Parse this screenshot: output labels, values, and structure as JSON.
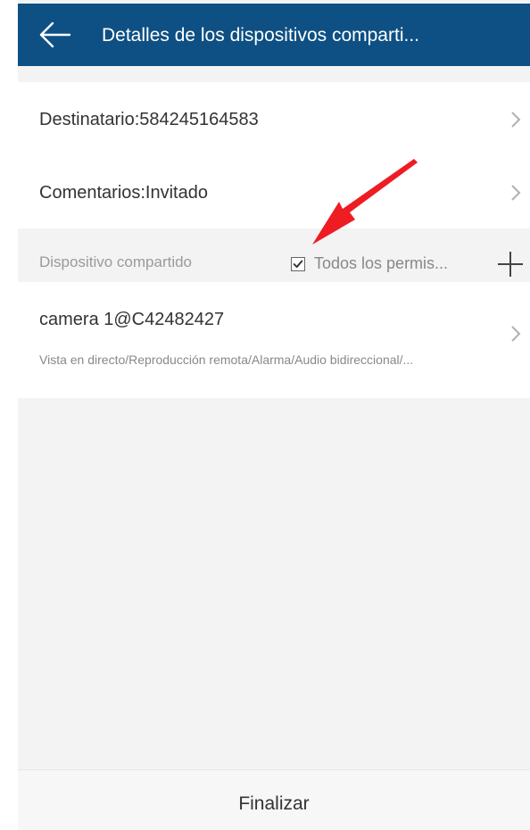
{
  "header": {
    "title": "Detalles de los dispositivos comparti..."
  },
  "rows": [
    {
      "label": "Destinatario:584245164583"
    },
    {
      "label": "Comentarios:Invitado"
    }
  ],
  "section": {
    "label": "Dispositivo compartido",
    "checkbox_label": "Todos los permis...",
    "checkbox_checked": true
  },
  "device": {
    "name": "camera 1@C42482427",
    "permissions": "Vista en directo/Reproducción remota/Alarma/Audio bidireccional/..."
  },
  "footer": {
    "button_label": "Finalizar"
  },
  "colors": {
    "header_bg": "#0e5084",
    "annotation_arrow": "#ee1d23"
  },
  "icons": {
    "back": "arrow-left-icon",
    "chevron": "chevron-right-icon",
    "add": "plus-icon",
    "check": "checkmark-icon",
    "annotation": "red-arrow-annotation"
  }
}
